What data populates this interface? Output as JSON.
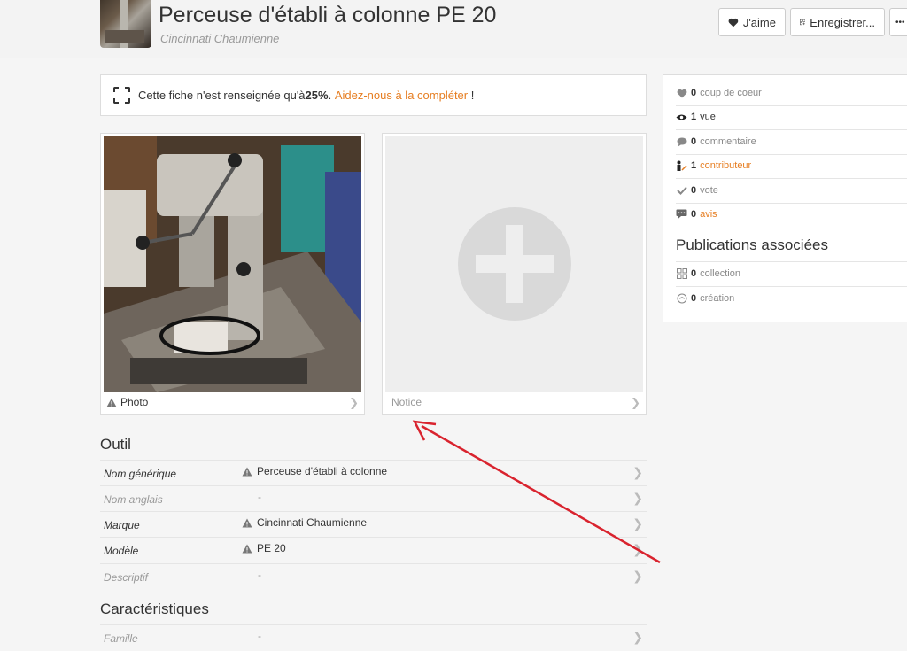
{
  "header": {
    "title": "Perceuse d'établi à colonne PE 20",
    "subtitle": "Cincinnati Chaumienne",
    "like_label": "J'aime",
    "save_label": "Enregistrer...",
    "more_label": "•••"
  },
  "banner": {
    "text_before": "Cette fiche n'est renseignée qu'à ",
    "percent": "25%",
    "text_after": ". ",
    "link": "Aidez-nous à la compléter",
    "end": " !"
  },
  "media": {
    "photo_caption": "Photo",
    "notice_caption": "Notice"
  },
  "stats": [
    {
      "count": "0",
      "label": "coup de coeur",
      "icon": "heart-icon",
      "highlight": false
    },
    {
      "count": "1",
      "label": "vue",
      "icon": "eye-icon",
      "highlight": false
    },
    {
      "count": "0",
      "label": "commentaire",
      "icon": "comment-icon",
      "highlight": false
    },
    {
      "count": "1",
      "label": "contributeur",
      "icon": "contributor-icon",
      "highlight": true
    },
    {
      "count": "0",
      "label": "vote",
      "icon": "check-icon",
      "highlight": false
    },
    {
      "count": "0",
      "label": "avis",
      "icon": "review-icon",
      "highlight": true
    }
  ],
  "publications": {
    "title": "Publications associées",
    "items": [
      {
        "count": "0",
        "label": "collection",
        "icon": "grid-icon"
      },
      {
        "count": "0",
        "label": "création",
        "icon": "creation-icon"
      }
    ]
  },
  "outil": {
    "title": "Outil",
    "rows": [
      {
        "label": "Nom générique",
        "value": "Perceuse d'établi à colonne",
        "warn": true
      },
      {
        "label": "Nom anglais",
        "value": "-",
        "warn": false
      },
      {
        "label": "Marque",
        "value": "Cincinnati Chaumienne",
        "warn": true
      },
      {
        "label": "Modèle",
        "value": "PE 20",
        "warn": true
      },
      {
        "label": "Descriptif",
        "value": "-",
        "warn": false
      }
    ]
  },
  "caracteristiques": {
    "title": "Caractéristiques",
    "rows": [
      {
        "label": "Famille",
        "value": "-",
        "warn": false
      }
    ]
  },
  "colors": {
    "accent": "#e67e22",
    "arrow": "#d9232e",
    "muted": "#999999"
  }
}
